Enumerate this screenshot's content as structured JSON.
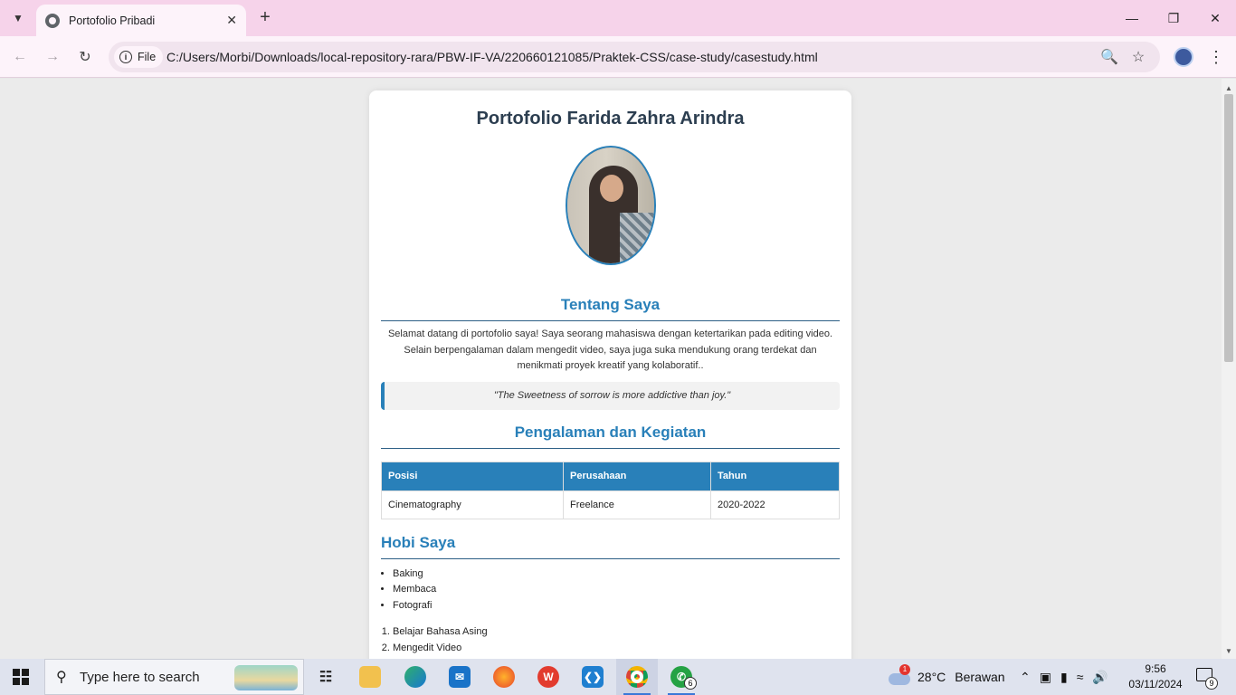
{
  "browser": {
    "tab_title": "Portofolio Pribadi",
    "new_tab_symbol": "+",
    "chip_label": "File",
    "url": "C:/Users/Morbi/Downloads/local-repository-rara/PBW-IF-VA/220660121085/Praktek-CSS/case-study/casestudy.html"
  },
  "page": {
    "title": "Portofolio Farida Zahra Arindra",
    "about": {
      "heading": "Tentang Saya",
      "text": "Selamat datang di portofolio saya! Saya seorang mahasiswa dengan ketertarikan pada editing video. Selain berpengalaman dalam mengedit video, saya juga suka mendukung orang terdekat dan menikmati proyek kreatif yang kolaboratif..",
      "quote": "\"The Sweetness of sorrow is more addictive than joy.\""
    },
    "experience": {
      "heading": "Pengalaman dan Kegiatan",
      "columns": [
        "Posisi",
        "Perusahaan",
        "Tahun"
      ],
      "rows": [
        [
          "Cinematography",
          "Freelance",
          "2020-2022"
        ]
      ]
    },
    "hobbies": {
      "heading": "Hobi Saya",
      "unordered": [
        "Baking",
        "Membaca",
        "Fotografi"
      ],
      "ordered": [
        "Belajar Bahasa Asing",
        "Mengedit Video"
      ]
    }
  },
  "taskbar": {
    "search_placeholder": "Type here to search",
    "whatsapp_badge": "6",
    "weather_badge": "1",
    "temperature": "28°C",
    "weather": "Berawan",
    "time": "9:56",
    "date": "03/11/2024",
    "notification_count": "9"
  }
}
